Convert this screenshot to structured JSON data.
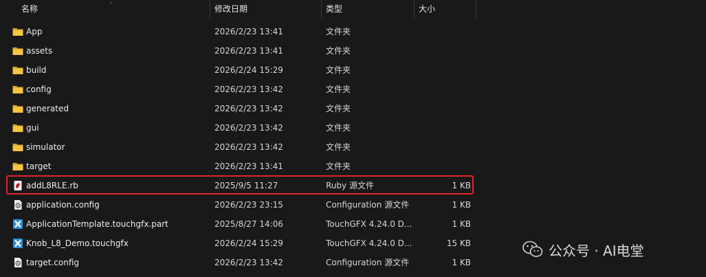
{
  "columns": {
    "name": "名称",
    "modified": "修改日期",
    "type": "类型",
    "size": "大小"
  },
  "files": [
    {
      "name": "App",
      "modified": "2026/2/23 13:41",
      "type": "文件夹",
      "size": "",
      "icon": "folder-icon"
    },
    {
      "name": "assets",
      "modified": "2026/2/23 13:41",
      "type": "文件夹",
      "size": "",
      "icon": "folder-icon"
    },
    {
      "name": "build",
      "modified": "2026/2/24 15:29",
      "type": "文件夹",
      "size": "",
      "icon": "folder-icon"
    },
    {
      "name": "config",
      "modified": "2026/2/23 13:42",
      "type": "文件夹",
      "size": "",
      "icon": "folder-icon"
    },
    {
      "name": "generated",
      "modified": "2026/2/23 13:42",
      "type": "文件夹",
      "size": "",
      "icon": "folder-icon"
    },
    {
      "name": "gui",
      "modified": "2026/2/23 13:42",
      "type": "文件夹",
      "size": "",
      "icon": "folder-icon"
    },
    {
      "name": "simulator",
      "modified": "2026/2/23 13:42",
      "type": "文件夹",
      "size": "",
      "icon": "folder-icon"
    },
    {
      "name": "target",
      "modified": "2026/2/23 13:41",
      "type": "文件夹",
      "size": "",
      "icon": "folder-icon"
    },
    {
      "name": "addL8RLE.rb",
      "modified": "2025/9/5 11:27",
      "type": "Ruby 源文件",
      "size": "1 KB",
      "icon": "ruby-file-icon"
    },
    {
      "name": "application.config",
      "modified": "2026/2/23 23:15",
      "type": "Configuration 源文件",
      "size": "1 KB",
      "icon": "config-file-icon"
    },
    {
      "name": "ApplicationTemplate.touchgfx.part",
      "modified": "2025/8/27 14:06",
      "type": "TouchGFX 4.24.0 D...",
      "size": "1 KB",
      "icon": "touchgfx-file-icon"
    },
    {
      "name": "Knob_L8_Demo.touchgfx",
      "modified": "2026/2/24 15:29",
      "type": "TouchGFX 4.24.0 D...",
      "size": "15 KB",
      "icon": "touchgfx-file-icon"
    },
    {
      "name": "target.config",
      "modified": "2026/2/23 13:42",
      "type": "Configuration 源文件",
      "size": "1 KB",
      "icon": "config-file-icon"
    }
  ],
  "highlighted_file": "addL8RLE.rb",
  "highlight_color": "#e0262a",
  "folder_color": "#f5c542",
  "watermark": {
    "text": "公众号 · AI电堂"
  }
}
